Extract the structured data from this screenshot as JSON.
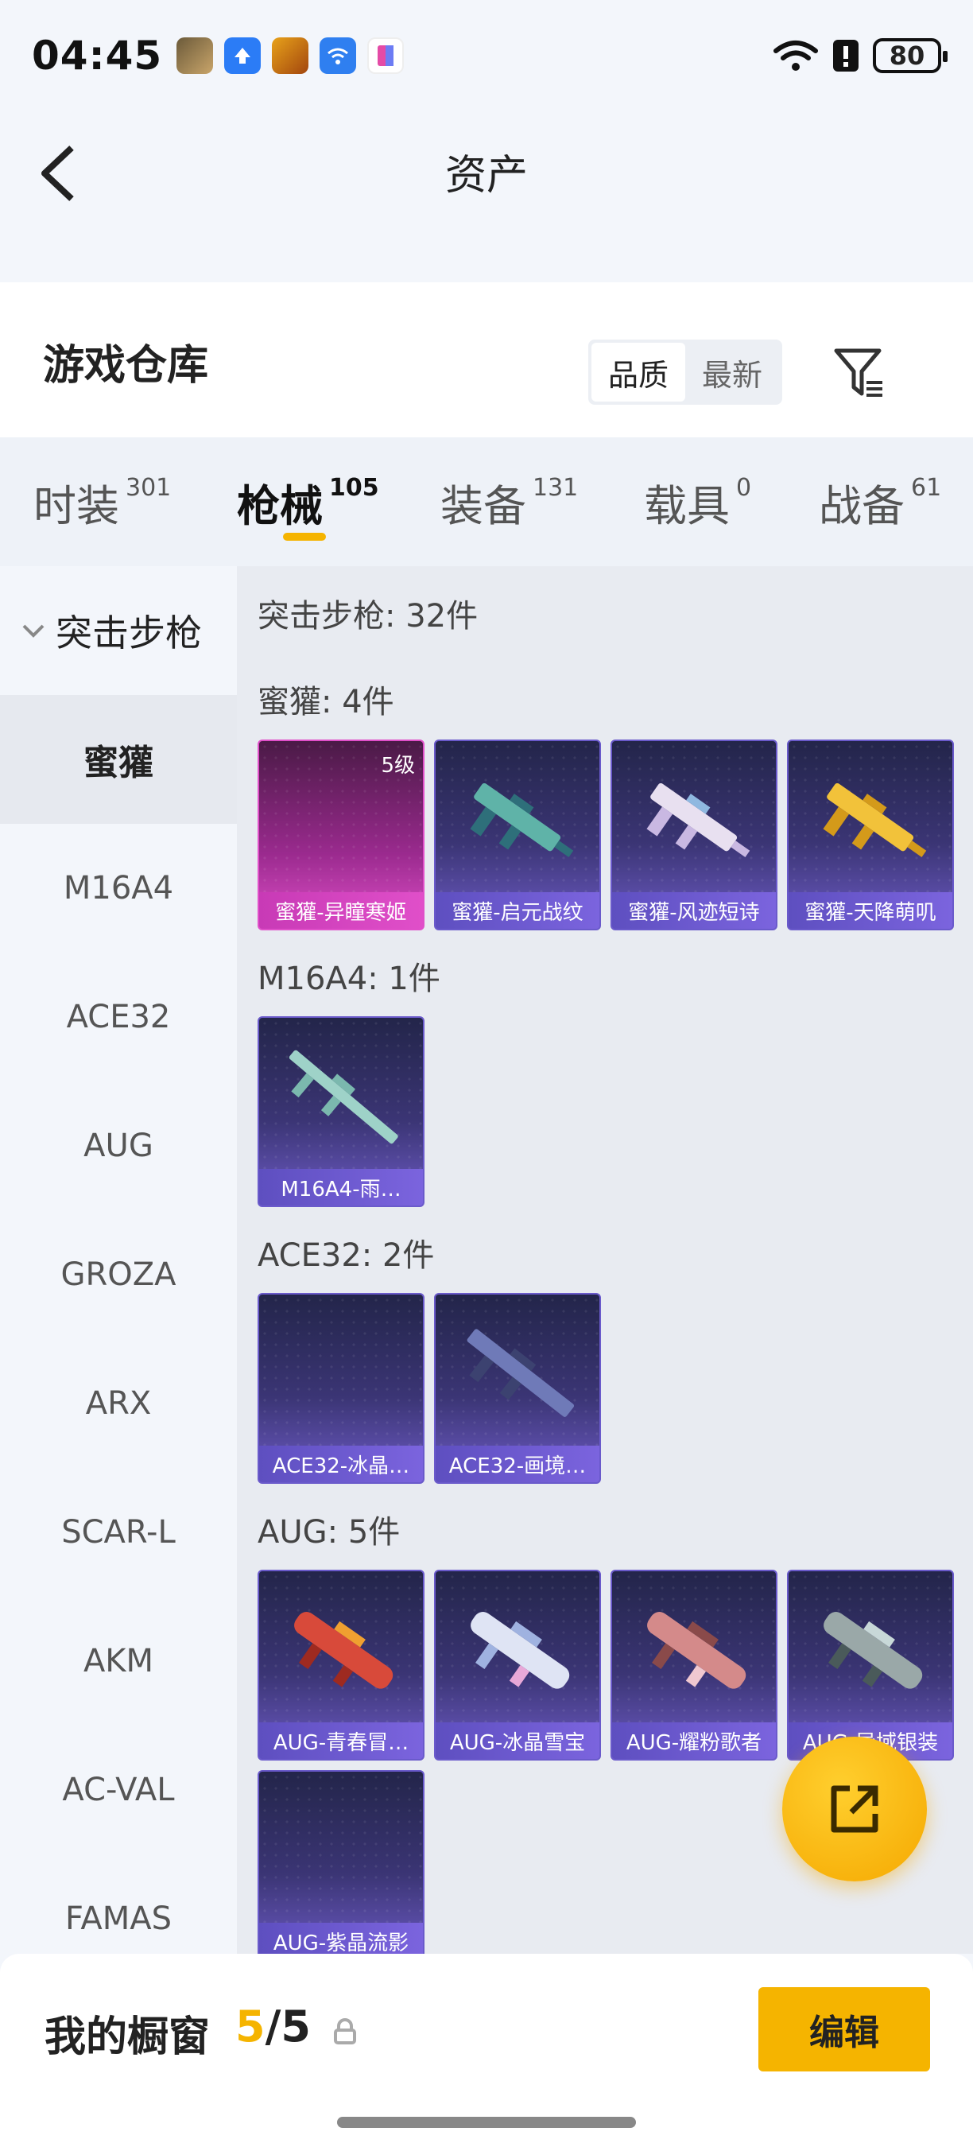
{
  "status": {
    "time": "04:45",
    "battery": "80"
  },
  "header": {
    "title": "资产"
  },
  "warehouse": {
    "title": "游戏仓库",
    "sort_options": [
      "品质",
      "最新"
    ],
    "sort_active": 0
  },
  "categories": [
    {
      "label": "时装",
      "count": "301"
    },
    {
      "label": "枪械",
      "count": "105"
    },
    {
      "label": "装备",
      "count": "131"
    },
    {
      "label": "载具",
      "count": "0"
    },
    {
      "label": "战备",
      "count": "61"
    }
  ],
  "active_category": 1,
  "sidebar": {
    "group": "突击步枪",
    "items": [
      "蜜獾",
      "M16A4",
      "ACE32",
      "AUG",
      "GROZA",
      "ARX",
      "SCAR-L",
      "AKM",
      "AC-VAL",
      "FAMAS"
    ],
    "active_item": 0
  },
  "content": {
    "summary": "突击步枪: 32件",
    "sections": [
      {
        "title": "蜜獾: 4件",
        "items": [
          "蜜獾-异瞳寒姬",
          "蜜獾-启元战纹",
          "蜜獾-风迹短诗",
          "蜜獾-天降萌叽"
        ],
        "first_level": "5级"
      },
      {
        "title": "M16A4: 1件",
        "items": [
          "M16A4-雨…"
        ]
      },
      {
        "title": "ACE32: 2件",
        "items": [
          "ACE32-冰晶…",
          "ACE32-画境…"
        ]
      },
      {
        "title": "AUG: 5件",
        "items": [
          "AUG-青春冒…",
          "AUG-冰晶雪宝",
          "AUG-耀粉歌者",
          "AUG-异域银装",
          "AUG-紫晶流影"
        ]
      }
    ]
  },
  "showcase": {
    "label": "我的橱窗",
    "current": "5",
    "sep": "/",
    "max": "5",
    "edit_label": "编辑"
  },
  "colors": {
    "accent": "#f5b400",
    "card_purple": "#6a5acb",
    "card_pink": "#e04fc9"
  }
}
